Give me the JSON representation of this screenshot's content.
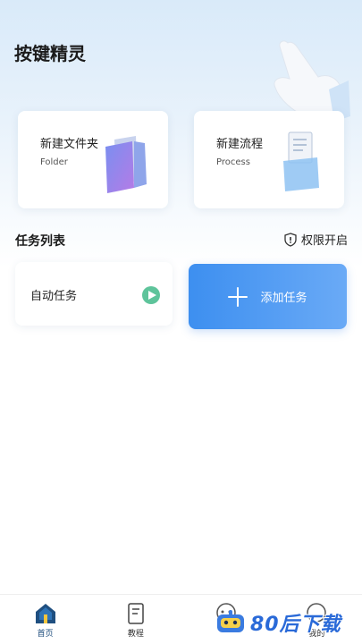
{
  "app": {
    "title": "按键精灵"
  },
  "quick_actions": [
    {
      "title": "新建文件夹",
      "subtitle": "Folder",
      "icon": "folder-icon"
    },
    {
      "title": "新建流程",
      "subtitle": "Process",
      "icon": "document-icon"
    }
  ],
  "task_list": {
    "title": "任务列表",
    "permission_label": "权限开启",
    "permission_icon": "shield-icon",
    "tasks": [
      {
        "label": "自动任务",
        "action_icon": "play-icon"
      }
    ],
    "add_task_label": "添加任务"
  },
  "tabs": [
    {
      "label": "首页",
      "icon": "home-icon",
      "active": true
    },
    {
      "label": "教程",
      "icon": "book-icon",
      "active": false
    },
    {
      "label": "",
      "icon": "robot-icon",
      "active": false
    },
    {
      "label": "我的",
      "icon": "user-icon",
      "active": false
    }
  ],
  "watermark": {
    "text": "80后下载"
  },
  "colors": {
    "accent": "#3d8ff0",
    "play_green": "#5ec49b",
    "tab_active": "#1a4a7a"
  }
}
